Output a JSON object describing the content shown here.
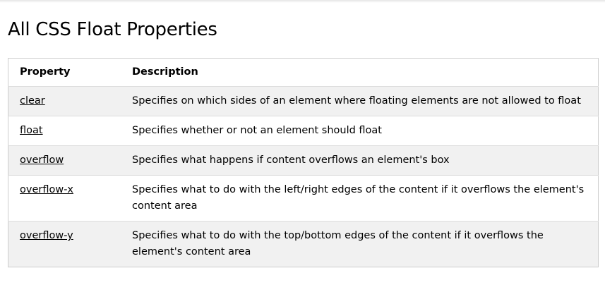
{
  "page": {
    "title": "All CSS Float Properties"
  },
  "table": {
    "headers": [
      "Property",
      "Description"
    ],
    "rows": [
      {
        "property": "clear",
        "description": "Specifies on which sides of an element where floating elements are not allowed to float"
      },
      {
        "property": "float",
        "description": "Specifies whether or not an element should float"
      },
      {
        "property": "overflow",
        "description": "Specifies what happens if content overflows an element's box"
      },
      {
        "property": "overflow-x",
        "description": "Specifies what to do with the left/right edges of the content if it overflows the element's content area"
      },
      {
        "property": "overflow-y",
        "description": "Specifies what to do with the top/bottom edges of the content if it overflows the element's content area"
      }
    ]
  },
  "colors": {
    "row_alt": "#f1f1f1",
    "border": "#cccccc",
    "text": "#000000"
  }
}
